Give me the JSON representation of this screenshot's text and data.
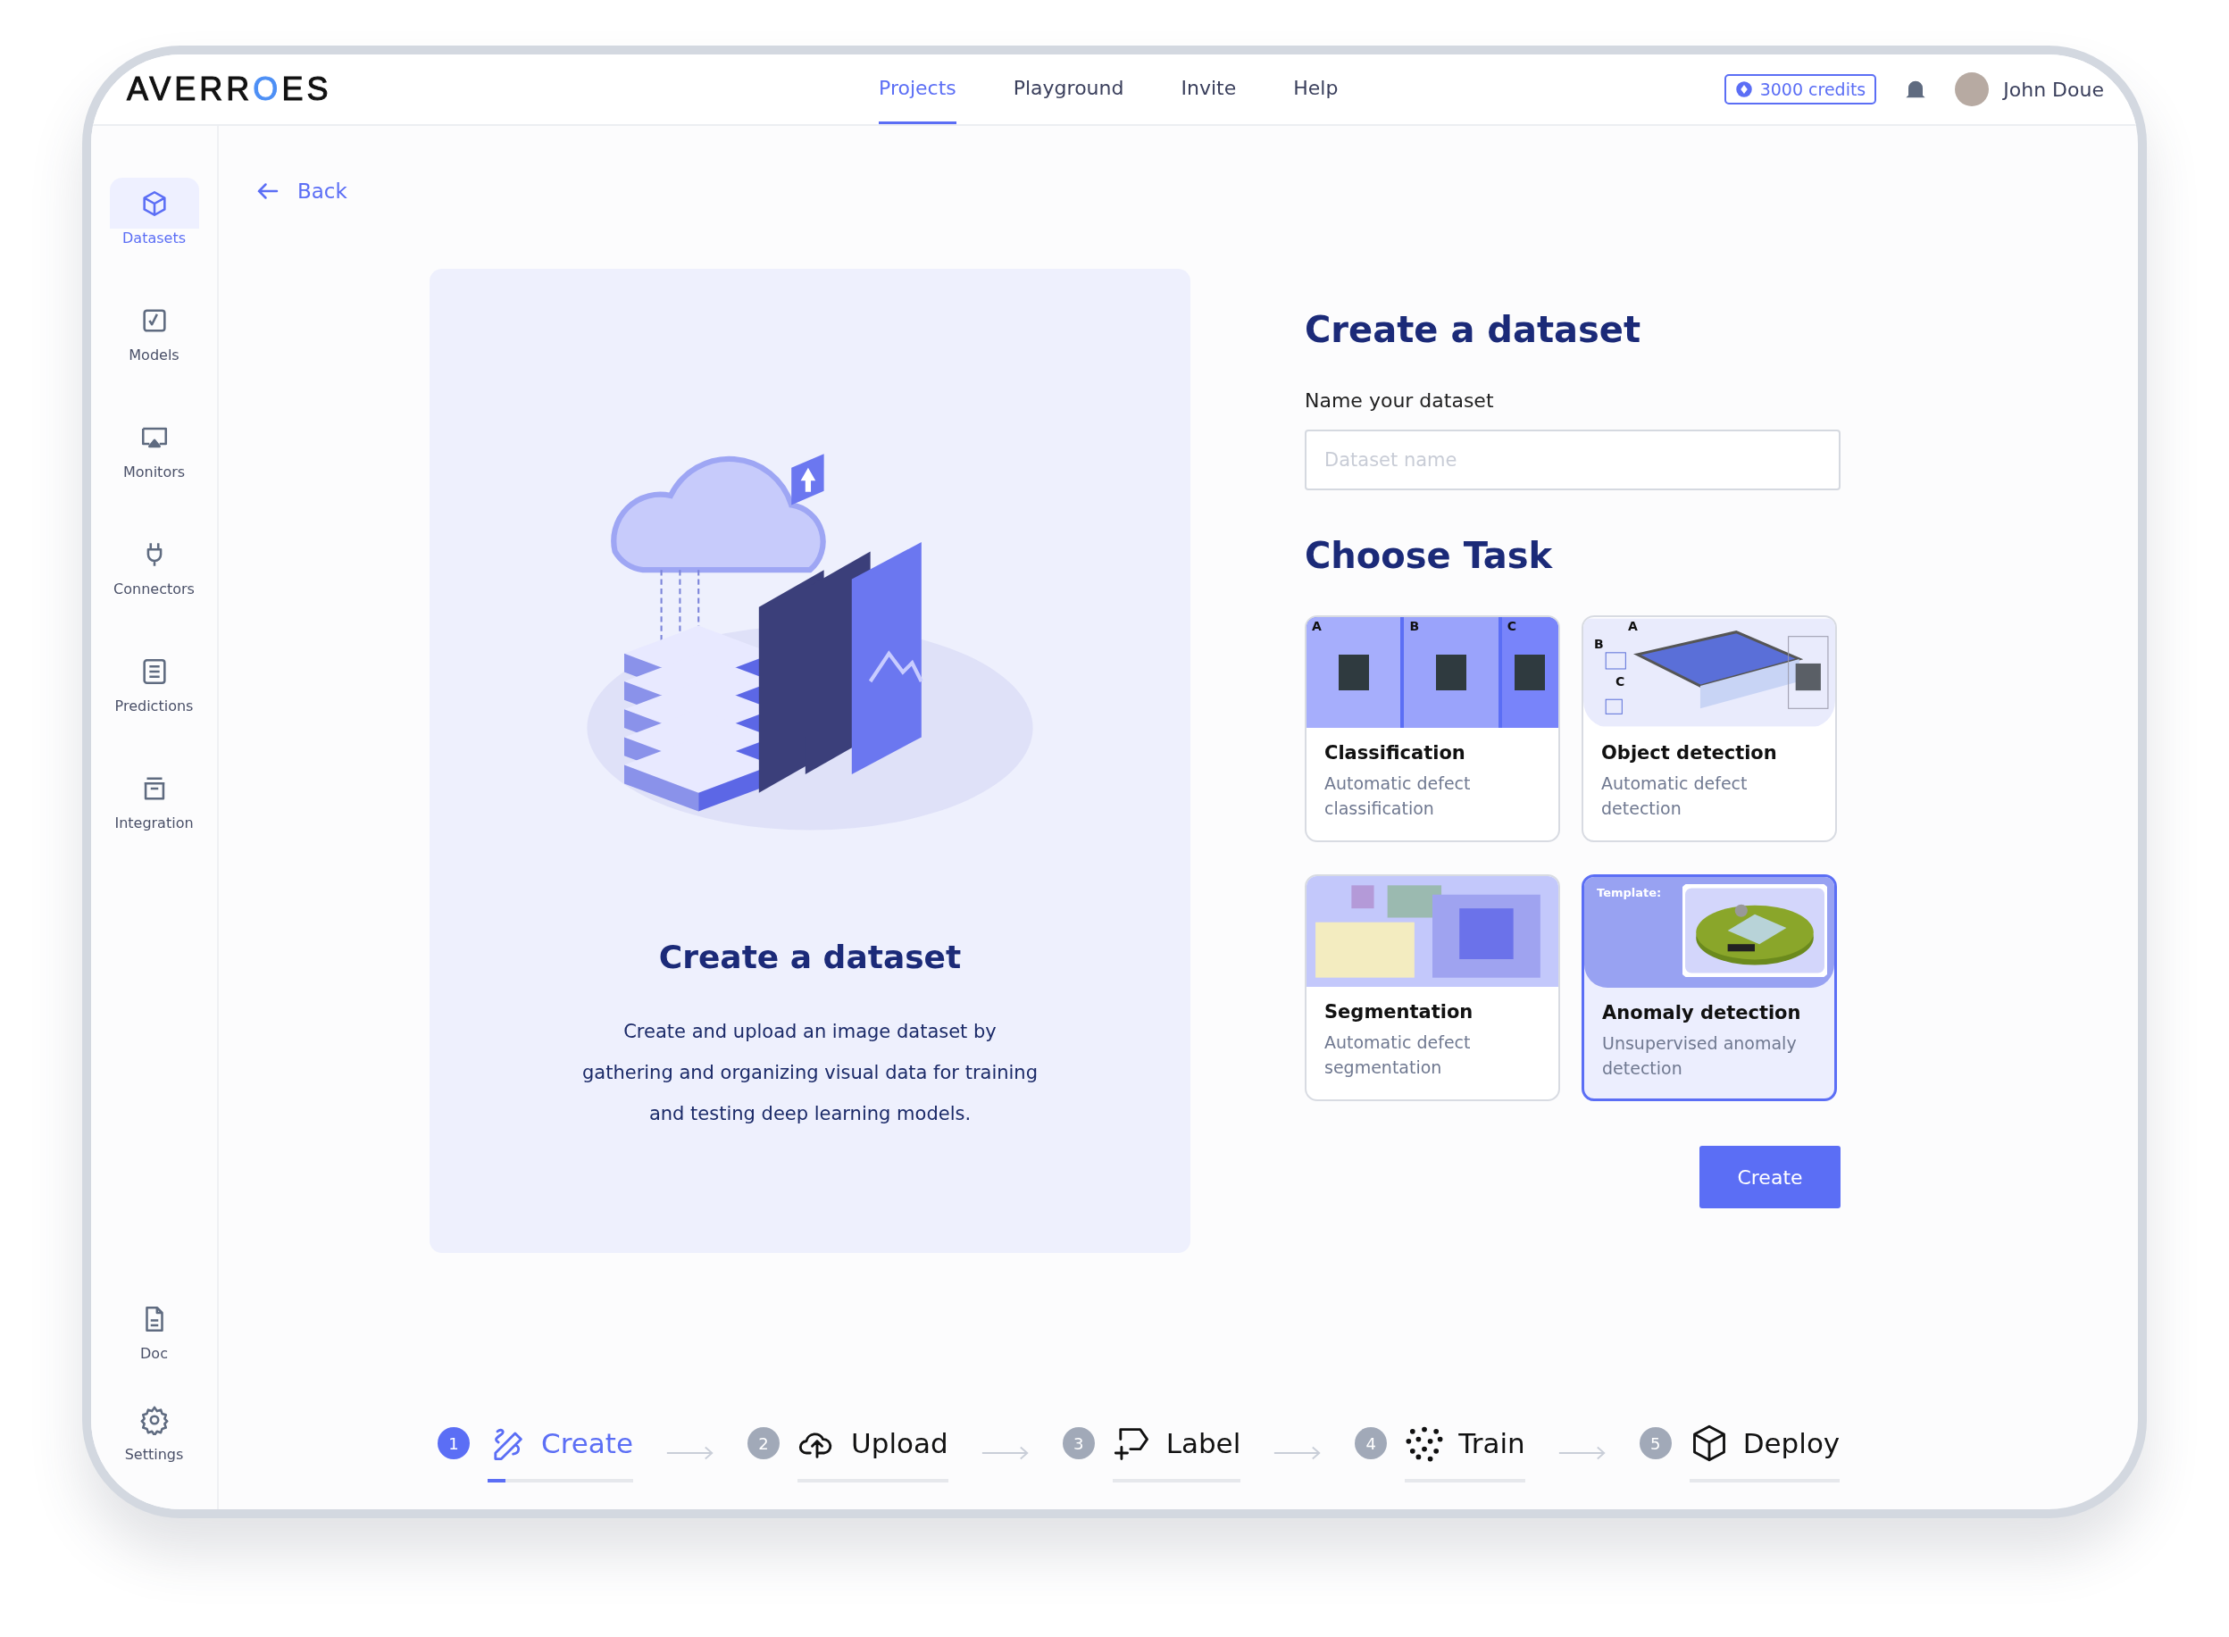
{
  "brand": "AVERROES",
  "nav": [
    {
      "label": "Projects",
      "selected": true
    },
    {
      "label": "Playground",
      "selected": false
    },
    {
      "label": "Invite",
      "selected": false
    },
    {
      "label": "Help",
      "selected": false
    }
  ],
  "credits": "3000 credits",
  "user": "John Doue",
  "sidebar": {
    "items": [
      {
        "label": "Datasets",
        "selected": true
      },
      {
        "label": "Models",
        "selected": false
      },
      {
        "label": "Monitors",
        "selected": false
      },
      {
        "label": "Connectors",
        "selected": false
      },
      {
        "label": "Predictions",
        "selected": false
      },
      {
        "label": "Integration",
        "selected": false
      }
    ],
    "bottom_items": [
      {
        "label": "Doc"
      },
      {
        "label": "Settings"
      }
    ]
  },
  "back": "Back",
  "intro": {
    "title": "Create a dataset",
    "text": "Create and upload an image dataset by gathering and organizing visual data for training and testing deep learning models."
  },
  "form": {
    "title": "Create a dataset",
    "name_label": "Name your dataset",
    "name_placeholder": "Dataset name",
    "task_title": "Choose Task",
    "tasks": [
      {
        "kind": "classification",
        "title": "Classification",
        "description": "Automatic defect classification",
        "selected": false,
        "labels": [
          "A",
          "B",
          "C"
        ]
      },
      {
        "kind": "detection",
        "title": "Object detection",
        "description": "Automatic defect detection",
        "selected": false,
        "labels": [
          "A",
          "B",
          "C"
        ]
      },
      {
        "kind": "segmentation",
        "title": "Segmentation",
        "description": "Automatic defect segmentation",
        "selected": false
      },
      {
        "kind": "anomaly",
        "title": "Anomaly detection",
        "description": "Unsupervised anomaly detection",
        "selected": true,
        "badge": "Template:"
      }
    ],
    "submit": "Create"
  },
  "steps": [
    {
      "number": "1",
      "label": "Create",
      "selected": true,
      "level": 0.12
    },
    {
      "number": "2",
      "label": "Upload",
      "selected": false
    },
    {
      "number": "3",
      "label": "Label",
      "selected": false
    },
    {
      "number": "4",
      "label": "Train",
      "selected": false
    },
    {
      "number": "5",
      "label": "Deploy",
      "selected": false
    }
  ]
}
